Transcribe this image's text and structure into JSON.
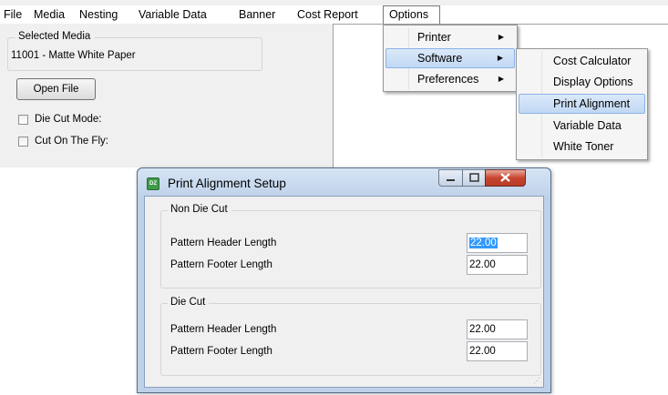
{
  "menubar": {
    "items": [
      "File",
      "Media",
      "Nesting",
      "Variable Data",
      "Banner",
      "Cost Report",
      "Options"
    ]
  },
  "media_group": {
    "legend": "Selected Media",
    "value": "11001 - Matte White Paper"
  },
  "open_file_button": "Open File",
  "checkboxes": {
    "die_cut_mode": "Die Cut Mode:",
    "cut_on_the_fly": "Cut On The Fly:"
  },
  "options_menu": {
    "items": [
      "Printer",
      "Software",
      "Preferences"
    ],
    "highlighted": "Software"
  },
  "software_submenu": {
    "items": [
      "Cost Calculator",
      "Display Options",
      "Print Alignment",
      "Variable Data",
      "White Toner"
    ],
    "highlighted": "Print Alignment"
  },
  "dialog": {
    "title": "Print Alignment Setup",
    "app_icon": "dz-app-icon",
    "non_die_cut": {
      "legend": "Non Die Cut",
      "header_label": "Pattern Header Length",
      "header_value": "22.00",
      "footer_label": "Pattern Footer Length",
      "footer_value": "22.00"
    },
    "die_cut": {
      "legend": "Die Cut",
      "header_label": "Pattern Header Length",
      "header_value": "22.00",
      "footer_label": "Pattern Footer Length",
      "footer_value": "22.00"
    }
  },
  "colors": {
    "highlight": "#c1d8f4",
    "selection": "#3399ff",
    "close_button": "#c7452f"
  }
}
